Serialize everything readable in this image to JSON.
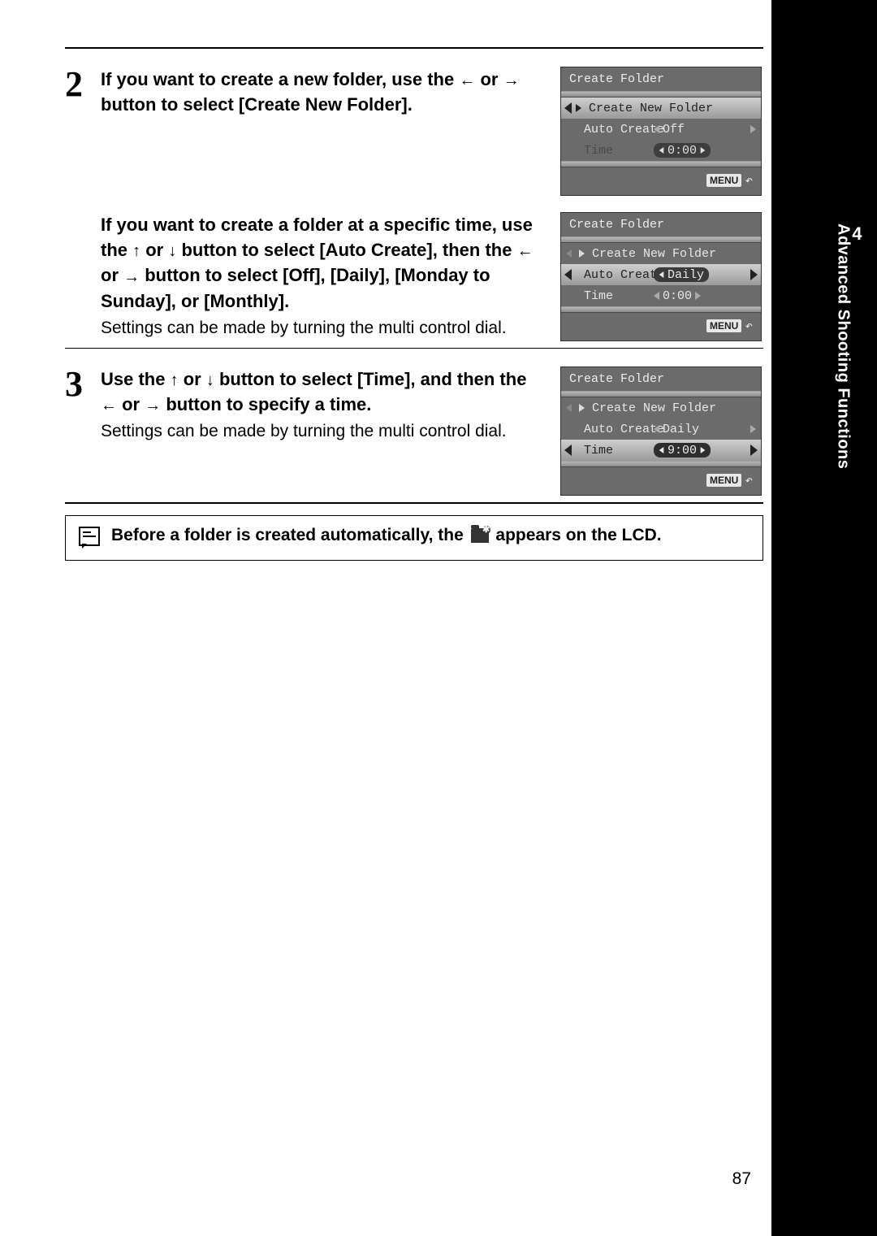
{
  "sidebar": {
    "chapter_num": "4",
    "chapter_title": "Advanced Shooting Functions"
  },
  "page_number": "87",
  "step2": {
    "num": "2",
    "p1a": "If you want to create a new folder, use the ",
    "p1b": " or ",
    "p1c": " button to select [Create New Folder].",
    "p2a": "If you want to create a folder at a specific time, use the ",
    "p2b": " or ",
    "p2c": " button to select [Auto Create], then the ",
    "p2d": " or ",
    "p2e": " button to select [Off], [Daily], [Monday to Sunday], or [Monthly].",
    "note": "Settings can be made by turning the multi control dial."
  },
  "step3": {
    "num": "3",
    "p1a": "Use the ",
    "p1b": " or ",
    "p1c": " button to select [Time], and then the ",
    "p1d": " or ",
    "p1e": " button to specify a time.",
    "note": "Settings can be made by turning the multi control dial."
  },
  "bottom_note_a": "Before a folder is created automatically, the ",
  "bottom_note_b": " appears on the LCD.",
  "cam1": {
    "title": "Create Folder",
    "create_new": "Create New Folder",
    "auto_create": "Auto Create",
    "auto_val": "Off",
    "time": "Time",
    "time_val": "0:00",
    "menu": "MENU"
  },
  "cam2": {
    "title": "Create Folder",
    "create_new": "Create New Folder",
    "auto_create": "Auto Create",
    "auto_val": "Daily",
    "time": "Time",
    "time_val": "0:00",
    "menu": "MENU"
  },
  "cam3": {
    "title": "Create Folder",
    "create_new": "Create New Folder",
    "auto_create": "Auto Create",
    "auto_val": "Daily",
    "time": "Time",
    "time_val": "9:00",
    "menu": "MENU"
  }
}
